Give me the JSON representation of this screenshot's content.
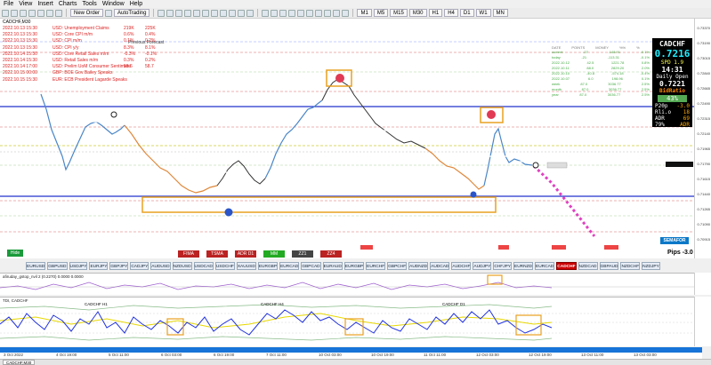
{
  "menu": [
    "File",
    "View",
    "Insert",
    "Charts",
    "Tools",
    "Window",
    "Help"
  ],
  "toolbar": {
    "new_order": "New Order",
    "autotrading": "AutoTrading"
  },
  "chart": {
    "title": "CADCHF,M30",
    "news_header": "Previous  Forecast",
    "news": [
      {
        "time": "2022.10.13 15:30",
        "event": "USD: Unemployment Claims",
        "prev": "219K",
        "fc": "225K"
      },
      {
        "time": "2022.10.13 15:30",
        "event": "USD: Core CPI m/m",
        "prev": "0.6%",
        "fc": "0.4%"
      },
      {
        "time": "2022.10.13 15:30",
        "event": "USD: CPI m/m",
        "prev": "0.1%",
        "fc": "0.2%"
      },
      {
        "time": "2022.10.13 15:30",
        "event": "USD: CPI y/y",
        "prev": "8.3%",
        "fc": "8.1%"
      },
      {
        "time": "2022.10.14 15:30",
        "event": "USD: Core Retail Sales m/m",
        "prev": "-0.3%",
        "fc": "-0.1%"
      },
      {
        "time": "2022.10.14 15:30",
        "event": "USD: Retail Sales m/m",
        "prev": "0.3%",
        "fc": "0.2%"
      },
      {
        "time": "2022.10.14 17:00",
        "event": "USD: Prelim UoM Consumer Sentiment",
        "prev": "58.6",
        "fc": "58.7"
      },
      {
        "time": "2022.10.15 00:00",
        "event": "GBP: BOE Gov Bailey Speaks",
        "prev": "",
        "fc": ""
      },
      {
        "time": "2022.10.15 15:30",
        "event": "EUR: ECB President Lagarde Speaks",
        "prev": "",
        "fc": ""
      }
    ],
    "dashboard_header": [
      "DATE",
      "POINTS",
      "MONEY",
      "%%",
      "%"
    ],
    "dashboard_rows": [
      {
        "date": "current",
        "pts": "-27",
        "money": "-148.91",
        "p1": "-0.1%",
        "p2": ""
      },
      {
        "date": "today",
        "pts": "-21",
        "money": "-113.31",
        "p1": "-0.1%",
        "p2": ""
      },
      {
        "date": "2022.10.12",
        "pts": "42.5",
        "money": "1221.78",
        "p1": "0.8%",
        "p2": ""
      },
      {
        "date": "2022.10.11",
        "pts": "88.0",
        "money": "2829.20",
        "p1": "2.0%",
        "p2": ""
      },
      {
        "date": "2022.10.10",
        "pts": "-40.8",
        "money": "-574.18",
        "p1": "-0.4%",
        "p2": ""
      },
      {
        "date": "2022.10.07",
        "pts": "6.0",
        "money": "198.96",
        "p1": "0.1%",
        "p2": ""
      },
      {
        "date": "week",
        "pts": "87.0",
        "money": "3036.77",
        "p1": "2.5%",
        "p2": ""
      },
      {
        "date": "month",
        "pts": "87.0",
        "money": "3036.77",
        "p1": "2.5%",
        "p2": ""
      },
      {
        "date": "year",
        "pts": "87.0",
        "money": "3036.77",
        "p1": "2.5%",
        "p2": ""
      }
    ],
    "price_labels": [
      "0.73370",
      "0.73190",
      "0.73015",
      "0.72840",
      "0.72665",
      "0.72490",
      "0.72315",
      "0.72140",
      "0.71965",
      "0.71790",
      "0.71615",
      "0.71440",
      "0.71265",
      "0.71090",
      "0.70915"
    ],
    "current_price_tag": "0.72160",
    "countdown": "04:30:26"
  },
  "info_panel": {
    "symbol": "CADCHF",
    "bid": "0.7216",
    "spread": "SPD 1.9",
    "time": "14:31",
    "daily_open_label": "Daily Open",
    "daily_open": "0.7221",
    "ratio_label": "BidRatio",
    "ratio": "43%",
    "kv": [
      {
        "k": "P20p",
        "v": "-3.0"
      },
      {
        "k": "Rli.o",
        "v": "18"
      },
      {
        "k": "ADR",
        "v": "69"
      },
      {
        "k": "79%",
        "v": "ADR"
      }
    ]
  },
  "semafor_label": "SEMAFOR",
  "pips": "Pips -3.0",
  "hide_button": "Hide",
  "indicator_buttons": [
    {
      "label": "FIMA",
      "color": "#b22"
    },
    {
      "label": "TSMA",
      "color": "#b22"
    },
    {
      "label": "ADR D1",
      "color": "#b22"
    },
    {
      "label": "MM",
      "color": "#2a2"
    },
    {
      "label": "ZZ1",
      "color": "#444"
    },
    {
      "label": "ZZ4",
      "color": "#b22"
    }
  ],
  "pairs": [
    "EURUSD",
    "GBPUSD",
    "USDJPY",
    "EURJPY",
    "GBPJPY",
    "CADJPY",
    "AUDUSD",
    "NZDUSD",
    "USDCAD",
    "USDCHF",
    "XAUUSD",
    "EURGBP",
    "EURCAD",
    "GBPCAD",
    "EURAUD",
    "EURGBP",
    "EURCHF",
    "GBPCHF",
    "AUDNZD",
    "AUDCAD",
    "AUDCHF",
    "AUDJPY",
    "CHFJPY",
    "EURNZD",
    "EURCAD",
    "CADCHF",
    "NZDCAD",
    "GBPAUD",
    "NZDCHF",
    "NZDJPY"
  ],
  "active_pair": "CADCHF",
  "ind1_label": "afiruday_gstop_nvil 2 (0.2270) 0.0000 0.0000",
  "ind2_label": "TDI, CADCHF",
  "ind2_tf": [
    "CADCHF H1",
    "CADCHF H4",
    "CADCHF D1"
  ],
  "time_labels": [
    "3 Oct 2022",
    "4 Oct 19:00",
    "5 Oct 11:00",
    "6 Oct 03:00",
    "6 Oct 19:00",
    "7 Oct 11:00",
    "10 Oct 03:00",
    "10 Oct 19:00",
    "11 Oct 11:00",
    "12 Oct 03:00",
    "12 Oct 19:00",
    "13 Oct 11:00",
    "13 Oct 03:00"
  ],
  "status_tab": "CADCHF,M30"
}
